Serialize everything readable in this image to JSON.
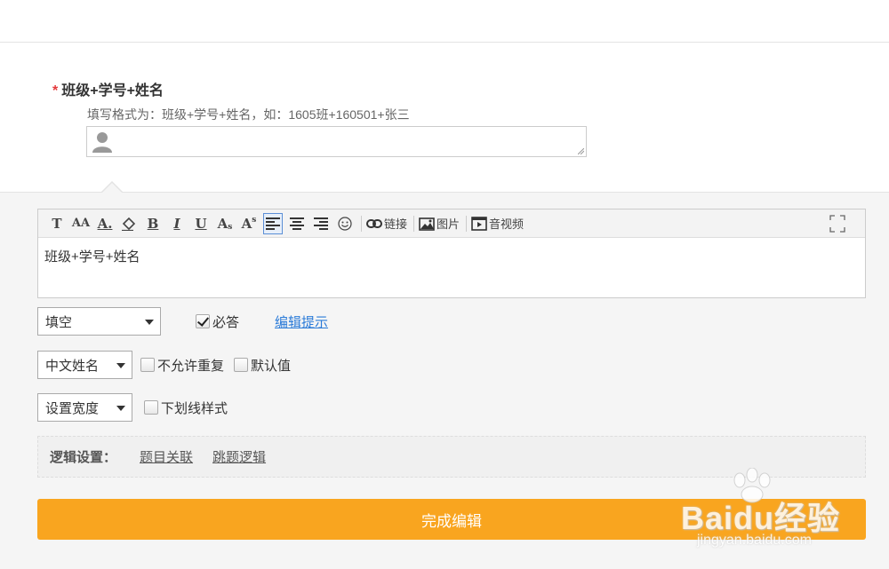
{
  "question": {
    "required_mark": "*",
    "title": "班级+学号+姓名",
    "hint": "填写格式为：班级+学号+姓名，如：1605班+160501+张三",
    "input_value": ""
  },
  "toolbar": {
    "buttons": [
      "T",
      "A",
      "A.",
      "◇.",
      "B",
      "I",
      "U",
      "A",
      "A",
      "≡",
      "≡",
      "≡",
      "☺"
    ],
    "link_label": "链接",
    "image_label": "图片",
    "video_label": "音视频"
  },
  "editor": {
    "content": "班级+学号+姓名"
  },
  "options": {
    "type_select": "填空",
    "required_label": "必答",
    "required_checked": true,
    "edit_hint_link": "编辑提示",
    "validation_select": "中文姓名",
    "no_repeat_label": "不允许重复",
    "no_repeat_checked": false,
    "default_label": "默认值",
    "default_checked": false,
    "width_select": "设置宽度",
    "underline_label": "下划线样式",
    "underline_checked": false
  },
  "logic": {
    "label": "逻辑设置：",
    "related_link": "题目关联",
    "jump_link": "跳题逻辑"
  },
  "done_button": "完成编辑",
  "watermark": {
    "brand": "Baidu经验",
    "url": "jingyan.baidu.com"
  },
  "colors": {
    "accent": "#f9a51f",
    "required": "#e4393c",
    "link": "#2b7bd8"
  }
}
